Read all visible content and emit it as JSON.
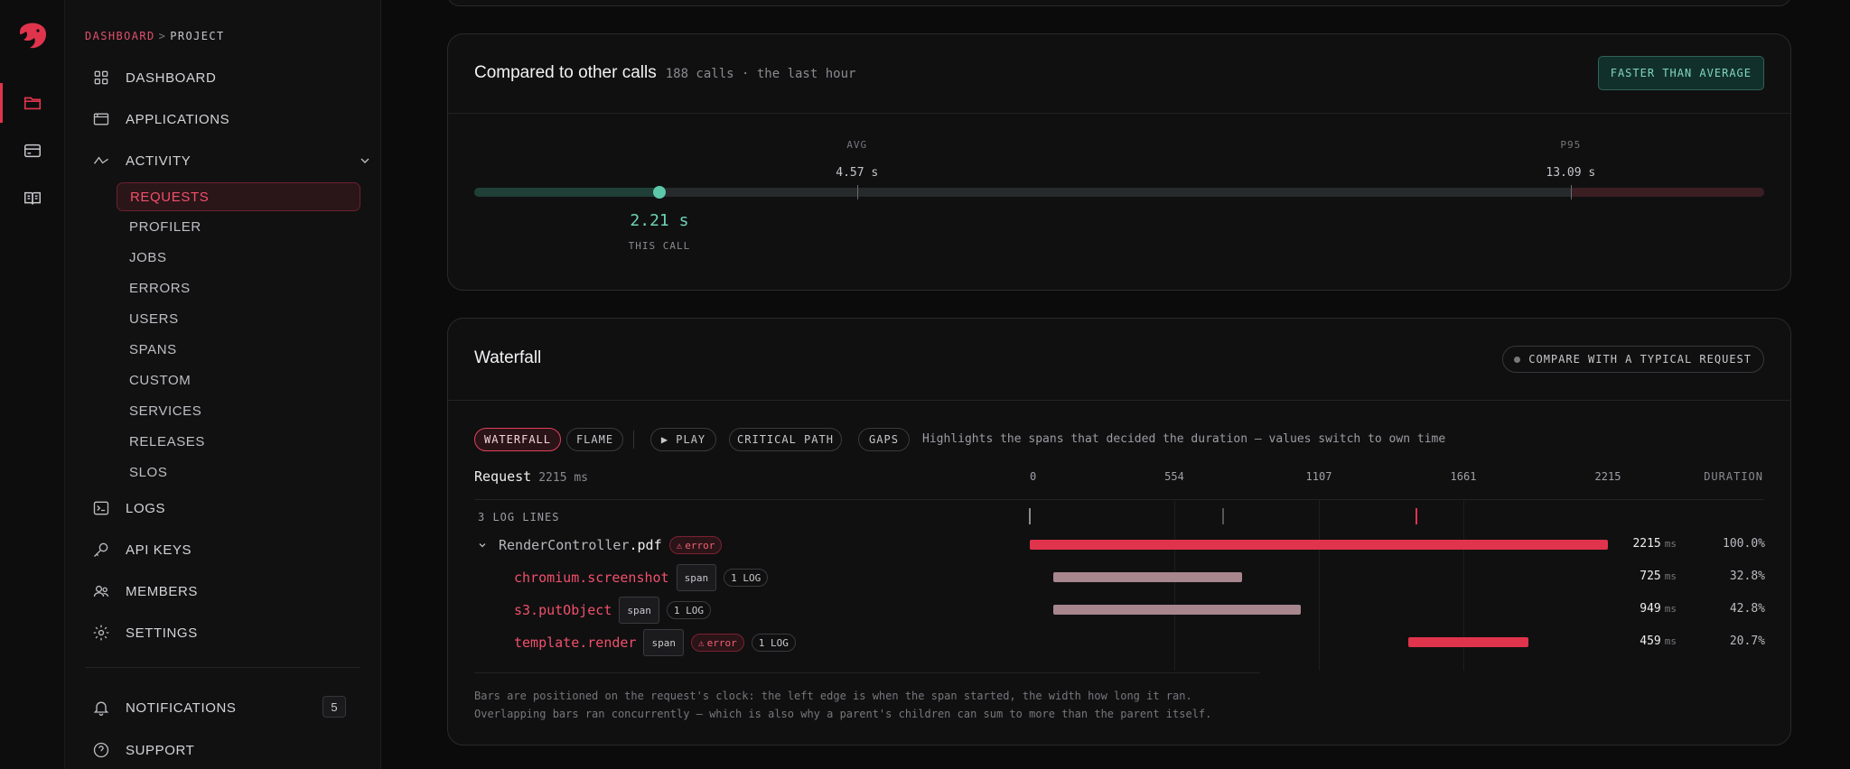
{
  "breadcrumb": {
    "first": "DASHBOARD",
    "separator": ">",
    "second": "PROJECT"
  },
  "nav": {
    "dashboard": "DASHBOARD",
    "applications": "APPLICATIONS",
    "activity": "ACTIVITY",
    "activity_items": [
      "REQUESTS",
      "PROFILER",
      "JOBS",
      "ERRORS",
      "USERS",
      "SPANS",
      "CUSTOM",
      "SERVICES",
      "RELEASES",
      "SLOS"
    ],
    "logs": "LOGS",
    "api_keys": "API KEYS",
    "members": "MEMBERS",
    "settings": "SETTINGS",
    "notifications": "NOTIFICATIONS",
    "notifications_count": "5",
    "support": "SUPPORT"
  },
  "compare": {
    "title": "Compared to other calls",
    "subtitle": "188 calls · the last hour",
    "badge": "FASTER THAN AVERAGE",
    "avg_label": "AVG",
    "avg_value": "4.57 s",
    "p95_label": "P95",
    "p95_value": "13.09 s",
    "this_value": "2.21 s",
    "this_label": "THIS CALL",
    "scale_max_s": 15.4,
    "this_s": 2.21,
    "avg_s": 4.57,
    "p95_s": 13.09
  },
  "waterfall": {
    "title": "Waterfall",
    "compare_button": "COMPARE WITH A TYPICAL REQUEST",
    "toolbar": {
      "waterfall": "WATERFALL",
      "flame": "FLAME",
      "play": "▶ PLAY",
      "critical": "CRITICAL PATH",
      "gaps": "GAPS",
      "hint": "Highlights the spans that decided the duration — values switch to own time"
    },
    "request_label": "Request",
    "request_ms": "2215 ms",
    "ticks": [
      "0",
      "554",
      "1107",
      "1661",
      "2215"
    ],
    "duration_header": "DURATION",
    "log_lines": "3 LOG LINES",
    "log_marks_ms": [
      0,
      740,
      1480
    ],
    "total_ms": 2215,
    "ms_unit": "ms",
    "rows": [
      {
        "name": "RenderController",
        "suffix": ".pdf",
        "error": "error",
        "start": 0,
        "dur": 2215,
        "duration": "2215",
        "pct": "100.0%",
        "color": "#e0344c"
      },
      {
        "name": "chromium.screenshot",
        "kind": "span",
        "logs": "1 LOG",
        "start": 90,
        "dur": 725,
        "duration": "725",
        "pct": "32.8%",
        "color": "#a7868e"
      },
      {
        "name": "s3.putObject",
        "kind": "span",
        "logs": "1 LOG",
        "start": 90,
        "dur": 949,
        "duration": "949",
        "pct": "42.8%",
        "color": "#a7868e"
      },
      {
        "name": "template.render",
        "kind": "span",
        "error": "error",
        "logs": "1 LOG",
        "start": 1450,
        "dur": 459,
        "duration": "459",
        "pct": "20.7%",
        "color": "#e0344c"
      }
    ],
    "footnote_1": "Bars are positioned on the request's clock: the left edge is when the span started, the width how long it ran.",
    "footnote_2": "Overlapping bars ran concurrently — which is also why a parent's children can sum to more than the parent itself."
  }
}
